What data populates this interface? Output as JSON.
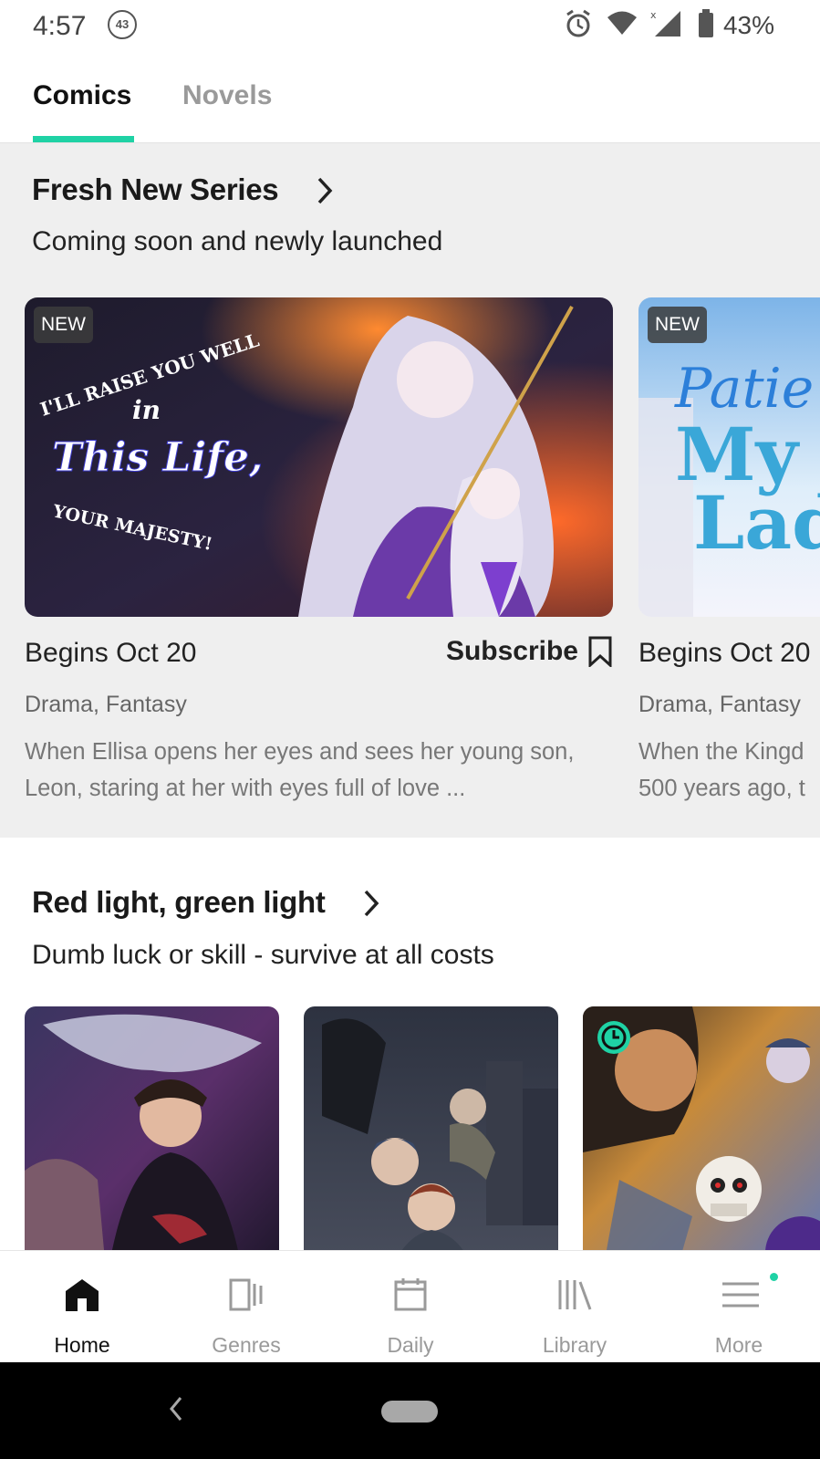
{
  "status_bar": {
    "time": "4:57",
    "notification_count": "43",
    "battery": "43%"
  },
  "top_tabs": [
    {
      "label": "Comics",
      "active": true
    },
    {
      "label": "Novels",
      "active": false
    }
  ],
  "fresh_section": {
    "title": "Fresh New Series",
    "subtitle": "Coming soon and newly launched",
    "cards": [
      {
        "badge": "NEW",
        "cover_text": [
          "I'LL RAISE YOU WELL",
          "in",
          "This Life,",
          "YOUR MAJESTY!"
        ],
        "begins": "Begins Oct 20",
        "subscribe_label": "Subscribe",
        "genres": "Drama, Fantasy",
        "description": "When Ellisa opens her eyes and sees her young son, Leon, staring at her with eyes full of love ..."
      },
      {
        "badge": "NEW",
        "cover_text": [
          "Patie",
          "My",
          "Lad"
        ],
        "begins": "Begins Oct 20",
        "genres": "Drama, Fantasy",
        "description_line1": "When the Kingd",
        "description_line2": "500 years ago, t"
      }
    ]
  },
  "red_green_section": {
    "title": "Red light, green light",
    "subtitle": "Dumb luck or skill - survive at all costs"
  },
  "bottom_nav": [
    {
      "label": "Home",
      "icon": "home-icon",
      "active": true
    },
    {
      "label": "Genres",
      "icon": "genres-icon",
      "active": false
    },
    {
      "label": "Daily",
      "icon": "daily-icon",
      "active": false
    },
    {
      "label": "Library",
      "icon": "library-icon",
      "active": false
    },
    {
      "label": "More",
      "icon": "menu-icon",
      "active": false
    }
  ],
  "colors": {
    "accent": "#1fd2a5",
    "section_bg": "#efefef"
  }
}
